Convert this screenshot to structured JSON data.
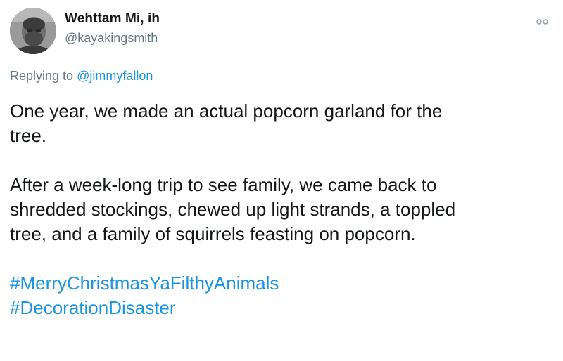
{
  "author": {
    "display_name": "Wehttam Mi, ih",
    "handle": "@kayakingsmith"
  },
  "reply": {
    "prefix": "Replying to ",
    "mention": "@jimmyfallon"
  },
  "body": {
    "paragraphs": [
      "One year, we made an actual popcorn garland for the\ntree.",
      "After a week-long trip to see family, we came back to\nshredded stockings, chewed up light strands, a toppled\ntree, and a family of squirrels feasting on popcorn."
    ],
    "hashtags": [
      "#MerryChristmasYaFilthyAnimals",
      "#DecorationDisaster"
    ]
  },
  "icons": {
    "more": "more-options-icon",
    "avatar": "user-avatar"
  },
  "colors": {
    "text": "#14171a",
    "secondary": "#657786",
    "link": "#1b95e0",
    "background": "#ffffff"
  }
}
